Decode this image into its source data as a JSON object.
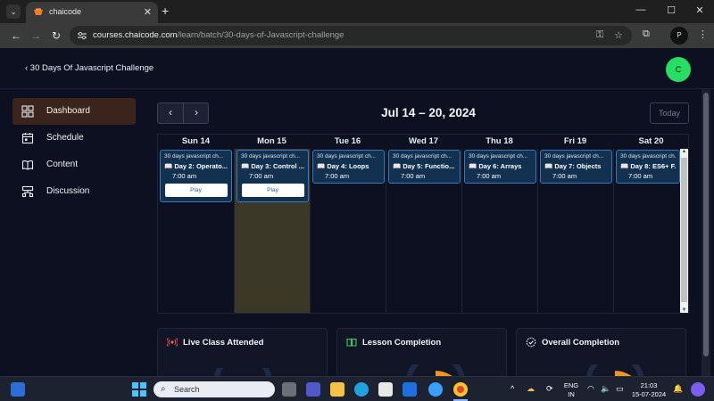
{
  "browser": {
    "tab_title": "chaicode",
    "tab_close": "✕",
    "new_tab": "+",
    "window_minimize": "—",
    "window_maximize": "☐",
    "window_close": "✕",
    "url_host": "courses.chaicode.com",
    "url_path": "/learn/batch/30-days-of-Javascript-challenge",
    "profile_initial": "P"
  },
  "header": {
    "back_label": "‹  30 Days Of Javascript Challenge",
    "avatar_initial": "C",
    "avatar_color": "#26de64"
  },
  "sidebar": {
    "items": [
      {
        "label": "Dashboard",
        "icon": "dashboard-icon",
        "active": true
      },
      {
        "label": "Schedule",
        "icon": "calendar-icon",
        "active": false
      },
      {
        "label": "Content",
        "icon": "book-icon",
        "active": false
      },
      {
        "label": "Discussion",
        "icon": "discussion-icon",
        "active": false
      }
    ]
  },
  "calendar": {
    "prev": "‹",
    "next": "›",
    "range_title": "Jul 14 – 20, 2024",
    "today_label": "Today",
    "days": [
      {
        "name": "Sun 14",
        "event": {
          "course": "30 days javascript ch...",
          "title": "Day 2: Operato...",
          "time": "7:00 am",
          "action": "Play"
        }
      },
      {
        "name": "Mon 15",
        "event": {
          "course": "30 days javascript ch...",
          "title": "Day 3: Control ...",
          "time": "7:00 am",
          "action": "Play"
        }
      },
      {
        "name": "Tue 16",
        "event": {
          "course": "30 days javascript ch...",
          "title": "Day 4: Loops",
          "time": "7:00 am"
        }
      },
      {
        "name": "Wed 17",
        "event": {
          "course": "30 days javascript ch...",
          "title": "Day 5: Functio...",
          "time": "7:00 am"
        }
      },
      {
        "name": "Thu 18",
        "event": {
          "course": "30 days javascript ch...",
          "title": "Day 6: Arrays",
          "time": "7:00 am"
        }
      },
      {
        "name": "Fri 19",
        "event": {
          "course": "30 days javascript ch...",
          "title": "Day 7: Objects",
          "time": "7:00 am"
        }
      },
      {
        "name": "Sat 20",
        "event": {
          "course": "30 days javascript ch...",
          "title": "Day 8: ES6+ F...",
          "time": "7:00 am"
        }
      }
    ]
  },
  "stats": {
    "live_class": "Live Class Attended",
    "lesson": "Lesson Completion",
    "overall": "Overall Completion"
  },
  "taskbar": {
    "search_placeholder": "Search",
    "lang_top": "ENG",
    "lang_bottom": "IN",
    "time": "21:03",
    "date": "15-07-2024"
  },
  "colors": {
    "accent": "#26de64",
    "active_nav": "#3a241c",
    "event_bg": "#123150",
    "event_border": "#3d78b8",
    "today_column": "#3b3828"
  }
}
